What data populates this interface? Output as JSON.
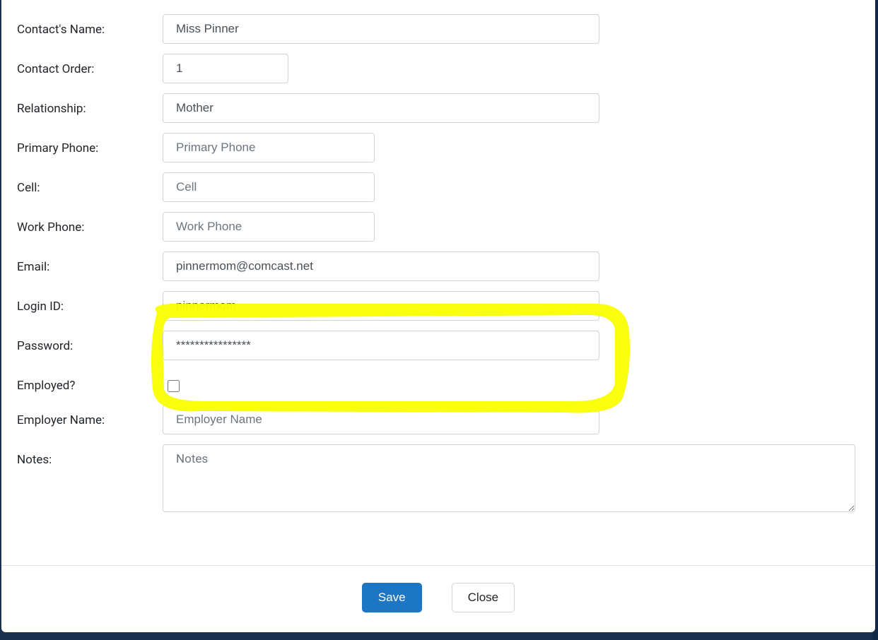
{
  "form": {
    "contact_name": {
      "label": "Contact's Name:",
      "value": "Miss Pinner"
    },
    "contact_order": {
      "label": "Contact Order:",
      "value": "1"
    },
    "relationship": {
      "label": "Relationship:",
      "value": "Mother"
    },
    "primary_phone": {
      "label": "Primary Phone:",
      "placeholder": "Primary Phone",
      "value": ""
    },
    "cell": {
      "label": "Cell:",
      "placeholder": "Cell",
      "value": ""
    },
    "work_phone": {
      "label": "Work Phone:",
      "placeholder": "Work Phone",
      "value": ""
    },
    "email": {
      "label": "Email:",
      "value": "pinnermom@comcast.net"
    },
    "login_id": {
      "label": "Login ID:",
      "value": "pinnermom"
    },
    "password": {
      "label": "Password:",
      "value": "****************"
    },
    "employed": {
      "label": "Employed?",
      "checked": false
    },
    "employer_name": {
      "label": "Employer Name:",
      "placeholder": "Employer Name",
      "value": ""
    },
    "notes": {
      "label": "Notes:",
      "placeholder": "Notes",
      "value": ""
    }
  },
  "buttons": {
    "save": "Save",
    "close": "Close"
  }
}
